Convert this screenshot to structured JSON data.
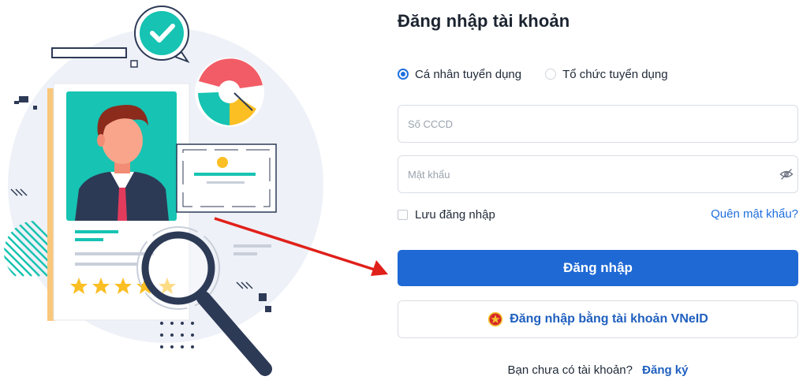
{
  "login": {
    "title": "Đăng nhập tài khoản",
    "account_types": [
      {
        "label": "Cá nhân tuyển dụng",
        "selected": true
      },
      {
        "label": "Tổ chức tuyển dụng",
        "selected": false
      }
    ],
    "cccd_placeholder": "Số CCCD",
    "password_placeholder": "Mật khẩu",
    "remember_label": "Lưu đăng nhập",
    "forgot_label": "Quên mật khẩu?",
    "submit_label": "Đăng nhập",
    "vneid_label": "Đăng nhập bằng tài khoản VNeID",
    "signup_question": "Bạn chưa có tài khoản?",
    "signup_link": "Đăng ký"
  },
  "illustration": {
    "rating_stars": 5
  },
  "colors": {
    "primary": "#1f69d5",
    "link": "#1f5fbf",
    "annotation_arrow": "#e0201a",
    "teal": "#17c3b2",
    "coral": "#f25c66",
    "gold": "#fbbf24"
  }
}
